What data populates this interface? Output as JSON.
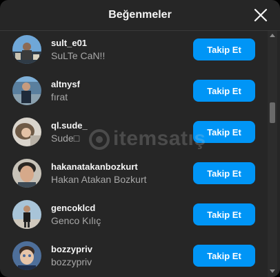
{
  "dialog": {
    "title": "Beğenmeler",
    "close_icon": "close-icon"
  },
  "likes": [
    {
      "username": "sult_e01",
      "full_name": "SuLTe CaN!!",
      "button": "Takip Et"
    },
    {
      "username": "altnysf",
      "full_name": "fırat",
      "button": "Takip Et"
    },
    {
      "username": "ql.sude_",
      "full_name": "Sude□",
      "button": "Takip Et"
    },
    {
      "username": "hakanatakanbozkurt",
      "full_name": "Hakan Atakan Bozkurt",
      "button": "Takip Et"
    },
    {
      "username": "gencoklcd",
      "full_name": "Genco Kılıç",
      "button": "Takip Et"
    },
    {
      "username": "bozzypriv",
      "full_name": "bozzypriv",
      "button": "Takip Et"
    }
  ],
  "watermark": {
    "text": "itemsatış"
  },
  "colors": {
    "dialog_bg": "#262626",
    "accent_button": "#0095f6",
    "primary_text": "#f5f5f5",
    "secondary_text": "#a8a8a8"
  }
}
